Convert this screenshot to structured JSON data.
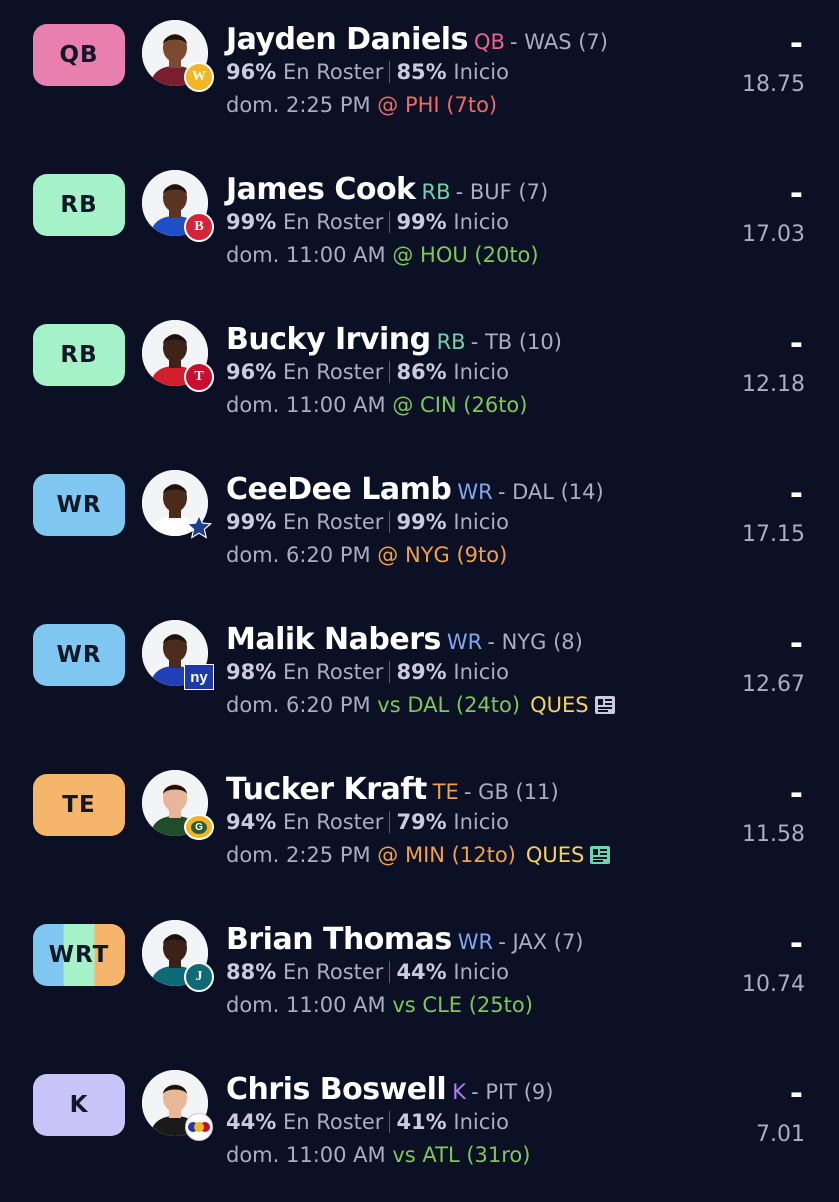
{
  "labels": {
    "roster": "En Roster",
    "start": "Inicio"
  },
  "colors": {
    "background": "#0b1024",
    "win": "#7ec85a",
    "mid": "#f0a04b",
    "bad": "#f06a6a",
    "ques": "#f5d35b"
  },
  "players": [
    {
      "slot": "QB",
      "slot_colors": [
        "#e87fae"
      ],
      "name": "Jayden Daniels",
      "pos": "QB",
      "pos_color": "#f0618e",
      "team_info": "- WAS (7)",
      "roster_pct": "96%",
      "start_pct": "85%",
      "time": "dom. 2:25 PM",
      "opponent": "@ PHI (7to)",
      "opp_color": "#f06a6a",
      "status": "",
      "status_icon": "",
      "dash": "-",
      "projection": "18.75",
      "avatar_icon": "player-avatar-icon",
      "team_logo_icon": "commanders-logo-icon",
      "skin": "#7a4a32",
      "jersey": "#7a1d2e",
      "logo_color": "#f2b526",
      "logo_glyph": "W"
    },
    {
      "slot": "RB",
      "slot_colors": [
        "#a5f2c8"
      ],
      "name": "James Cook",
      "pos": "RB",
      "pos_color": "#6fd4ad",
      "team_info": "- BUF (7)",
      "roster_pct": "99%",
      "start_pct": "99%",
      "time": "dom. 11:00 AM",
      "opponent": "@ HOU (20to)",
      "opp_color": "#7ec85a",
      "status": "",
      "status_icon": "",
      "dash": "-",
      "projection": "17.03",
      "avatar_icon": "player-avatar-icon",
      "team_logo_icon": "bills-logo-icon",
      "skin": "#5a3524",
      "jersey": "#1f4ec9",
      "logo_color": "#d6243a",
      "logo_glyph": "B"
    },
    {
      "slot": "RB",
      "slot_colors": [
        "#a5f2c8"
      ],
      "name": "Bucky Irving",
      "pos": "RB",
      "pos_color": "#6fd4ad",
      "team_info": "- TB (10)",
      "roster_pct": "96%",
      "start_pct": "86%",
      "time": "dom. 11:00 AM",
      "opponent": "@ CIN (26to)",
      "opp_color": "#7ec85a",
      "status": "",
      "status_icon": "",
      "dash": "-",
      "projection": "12.18",
      "avatar_icon": "player-avatar-icon",
      "team_logo_icon": "buccaneers-logo-icon",
      "skin": "#3e2418",
      "jersey": "#d11f2d",
      "logo_color": "#c8102e",
      "logo_glyph": "T"
    },
    {
      "slot": "WR",
      "slot_colors": [
        "#7fc7f0"
      ],
      "name": "CeeDee Lamb",
      "pos": "WR",
      "pos_color": "#7fa8f0",
      "team_info": "- DAL (14)",
      "roster_pct": "99%",
      "start_pct": "99%",
      "time": "dom. 6:20 PM",
      "opponent": "@ NYG (9to)",
      "opp_color": "#f0a04b",
      "status": "",
      "status_icon": "",
      "dash": "-",
      "projection": "17.15",
      "avatar_icon": "player-avatar-icon",
      "team_logo_icon": "cowboys-star-icon",
      "skin": "#4a2a1a",
      "jersey": "#ffffff",
      "logo_color": "#1c3f8f",
      "logo_glyph": "★"
    },
    {
      "slot": "WR",
      "slot_colors": [
        "#7fc7f0"
      ],
      "name": "Malik Nabers",
      "pos": "WR",
      "pos_color": "#7fa8f0",
      "team_info": "- NYG (8)",
      "roster_pct": "98%",
      "start_pct": "89%",
      "time": "dom. 6:20 PM",
      "opponent": "vs DAL (24to)",
      "opp_color": "#7ec85a",
      "status": "QUES",
      "status_icon": "news-icon",
      "dash": "-",
      "projection": "12.67",
      "avatar_icon": "player-avatar-icon",
      "team_logo_icon": "giants-logo-icon",
      "skin": "#4b2c1c",
      "jersey": "#2140b8",
      "logo_color": "#1e3aa8",
      "logo_glyph": "ny"
    },
    {
      "slot": "TE",
      "slot_colors": [
        "#f5b56a"
      ],
      "name": "Tucker Kraft",
      "pos": "TE",
      "pos_color": "#f0a04b",
      "team_info": "- GB (11)",
      "roster_pct": "94%",
      "start_pct": "79%",
      "time": "dom. 2:25 PM",
      "opponent": "@ MIN (12to)",
      "opp_color": "#f0a04b",
      "status": "QUES",
      "status_icon": "news-icon",
      "dash": "-",
      "projection": "11.58",
      "avatar_icon": "player-avatar-icon",
      "team_logo_icon": "packers-logo-icon",
      "skin": "#e6b59a",
      "jersey": "#1f4d2b",
      "logo_color": "#2b5e2f",
      "logo_glyph": "G"
    },
    {
      "slot": "WRT",
      "slot_colors": [
        "#7fc7f0",
        "#a5f2c8",
        "#f5b56a"
      ],
      "name": "Brian Thomas",
      "pos": "WR",
      "pos_color": "#7fa8f0",
      "team_info": "- JAX (7)",
      "roster_pct": "88%",
      "start_pct": "44%",
      "time": "dom. 11:00 AM",
      "opponent": "vs CLE (25to)",
      "opp_color": "#7ec85a",
      "status": "",
      "status_icon": "",
      "dash": "-",
      "projection": "10.74",
      "avatar_icon": "player-avatar-icon",
      "team_logo_icon": "jaguars-logo-icon",
      "skin": "#3b2216",
      "jersey": "#0e6a76",
      "logo_color": "#0e6a76",
      "logo_glyph": "J"
    },
    {
      "slot": "K",
      "slot_colors": [
        "#c8c4f7"
      ],
      "name": "Chris Boswell",
      "pos": "K",
      "pos_color": "#b27ff0",
      "team_info": "- PIT (9)",
      "roster_pct": "44%",
      "start_pct": "41%",
      "time": "dom. 11:00 AM",
      "opponent": "vs ATL (31ro)",
      "opp_color": "#7ec85a",
      "status": "",
      "status_icon": "",
      "dash": "-",
      "projection": "7.01",
      "avatar_icon": "player-avatar-icon",
      "team_logo_icon": "steelers-logo-icon",
      "skin": "#e8b896",
      "jersey": "#1a1a1a",
      "logo_color": "#111111",
      "logo_glyph": "S"
    }
  ]
}
